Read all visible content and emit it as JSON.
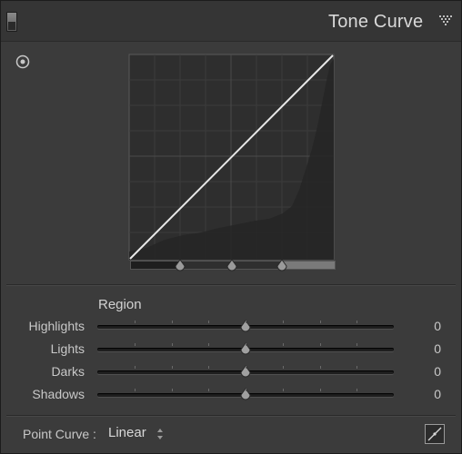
{
  "panel": {
    "title": "Tone Curve",
    "icons": {
      "panel_toggle": "panel-switch-icon",
      "collapse": "triangle-down-icon",
      "target_tool": "target-adjustment-icon",
      "edit_point_curve": "edit-point-curve-icon"
    }
  },
  "curve": {
    "mode": "linear",
    "background": "#2e2e2e",
    "grid_color": "#3d3d3d",
    "histogram_color": "#262626",
    "line_color": "#e8e8e8",
    "split_points": [
      25,
      50,
      75
    ]
  },
  "region": {
    "heading": "Region",
    "sliders": [
      {
        "label": "Highlights",
        "value": "0",
        "position": 0.5
      },
      {
        "label": "Lights",
        "value": "0",
        "position": 0.5
      },
      {
        "label": "Darks",
        "value": "0",
        "position": 0.5
      },
      {
        "label": "Shadows",
        "value": "0",
        "position": 0.5
      }
    ]
  },
  "point_curve": {
    "label": "Point Curve :",
    "selected": "Linear"
  }
}
